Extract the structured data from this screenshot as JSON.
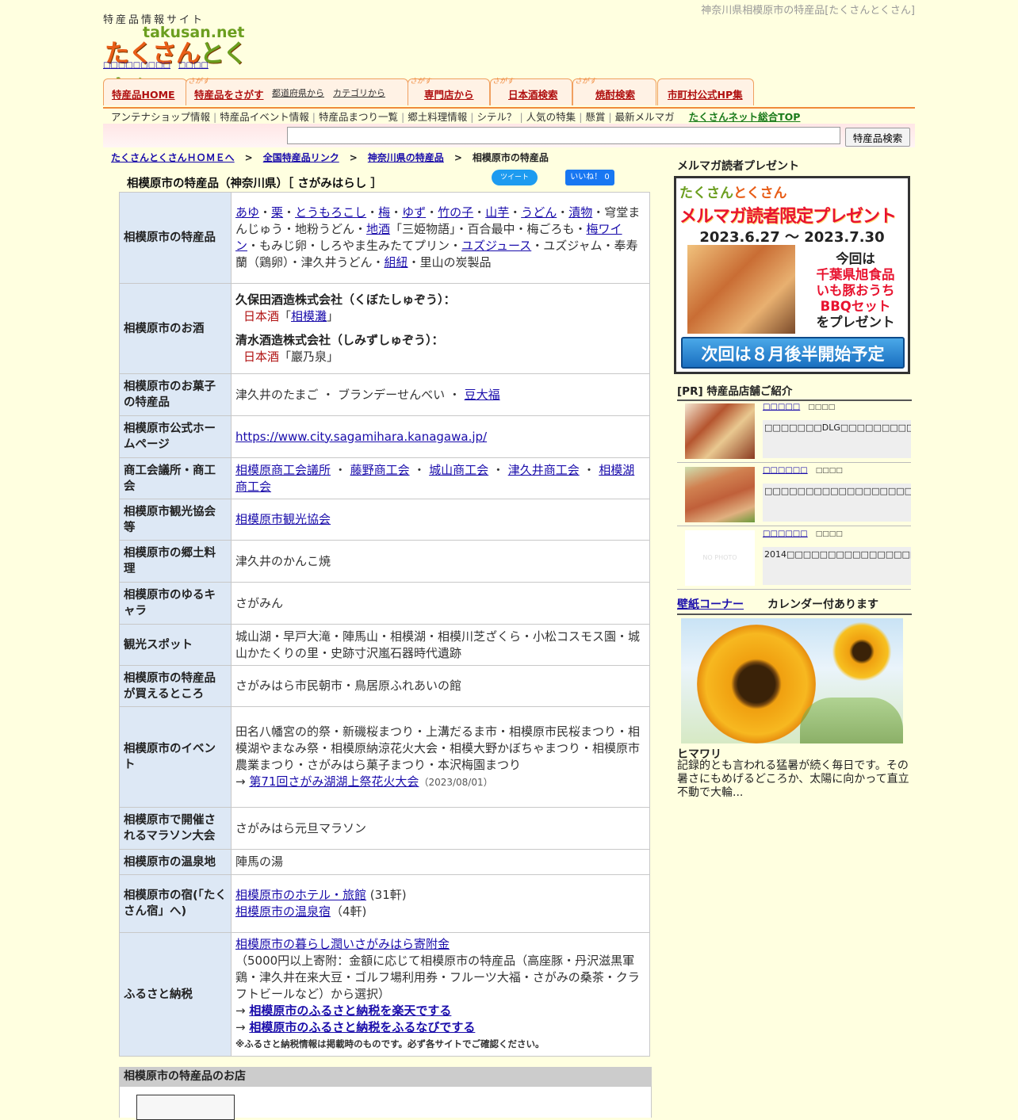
{
  "header": {
    "site_tag": "特産品情報サイト",
    "logo_top": "takusan.net",
    "logo_main": "たくさんとくさん",
    "logo_main_a": "たくさん",
    "logo_main_b": "とくさん",
    "page_heading": "神奈川県相模原市の特産品[たくさんとくさん]"
  },
  "tabs": [
    {
      "label": "特産品HOME"
    },
    {
      "label": "特産品をさがす",
      "badge": "さがす",
      "sub1": "都道府県から",
      "sub2": "カテゴリから"
    },
    {
      "label": "専門店から",
      "badge": "さがす"
    },
    {
      "label": "日本酒検索",
      "badge": "さがす"
    },
    {
      "label": "焼酎検索",
      "badge": "さがす"
    },
    {
      "label": "市町村公式HP集"
    }
  ],
  "sublinks": [
    "アンテナショップ情報",
    "特産品イベント情報",
    "特産品まつり一覧",
    "郷土料理情報",
    "シテル？",
    "人気の特集",
    "懸賞",
    "最新メルマガ"
  ],
  "sublinks_top": "たくさんネット総合TOP",
  "search": {
    "button": "特産品検索"
  },
  "breadcrumb": [
    "たくさんとくさんＨＯＭＥへ",
    "全国特産品リンク",
    "神奈川県の特産品",
    "相模原市の特産品"
  ],
  "breadcrumb_sep": ">",
  "title": "相模原市の特産品（神奈川県）［ さがみはらし ］",
  "social": {
    "tweet": "ツイート",
    "like": "いいね！ 0"
  },
  "table": {
    "specialty_h": "相模原市の特産品",
    "specialty_links": [
      "あゆ",
      "栗",
      "とうもろこし",
      "梅",
      "ゆず",
      "竹の子",
      "山芋",
      "うどん",
      "漬物"
    ],
    "specialty_t1": "・穹堂まんじゅう・地粉うどん・",
    "specialty_l2": "地酒",
    "specialty_t2": "「三姫物語」・百合最中・梅ごろも・",
    "specialty_l3": "梅ワイン",
    "specialty_t3": "・もみじ卵・しろやま生みたてプリン・",
    "specialty_l4": "ユズジュース",
    "specialty_t4": "・ユズジャム・奉寿蘭（鶏卵）・津久井うどん・",
    "specialty_l5": "組紐",
    "specialty_t5": "・里山の炭製品",
    "sake_h": "相模原市のお酒",
    "brewer1": "久保田酒造株式会社（くぼたしゅぞう）：",
    "sake_type": "日本酒",
    "brand1": "相模灘",
    "brewer2": "清水酒造株式会社（しみずしゅぞう）：",
    "brand2": "巖乃泉",
    "sweets_h": "相模原市のお菓子の特産品",
    "sweets_t": "津久井のたまご ・ ブランデーせんべい ・ ",
    "sweets_l": "豆大福",
    "hp_h": "相模原市公式ホームページ",
    "hp_url": "https://www.city.sagamihara.kanagawa.jp/",
    "chamber_h": "商工会議所・商工会",
    "chambers": [
      "相模原商工会議所",
      "藤野商工会",
      "城山商工会",
      "津久井商工会",
      "相模湖商工会"
    ],
    "tourism_h": "相模原市観光協会等",
    "tourism_l": "相模原市観光協会",
    "local_food_h": "相模原市の郷土料理",
    "local_food": "津久井のかんこ焼",
    "mascot_h": "相模原市のゆるキャラ",
    "mascot": "さがみん",
    "spots_h": "観光スポット",
    "spots": "城山湖・早戸大滝・陣馬山・相模湖・相模川芝ざくら・小松コスモス園・城山かたくりの里・史跡寸沢嵐石器時代遺跡",
    "buy_h": "相模原市の特産品が買えるところ",
    "buy": "さがみはら市民朝市・鳥居原ふれあいの館",
    "event_h": "相模原市のイベント",
    "events": "田名八幡宮の的祭・新磯桜まつり・上溝だるま市・相模原市民桜まつり・相模湖やまなみ祭・相模原納涼花火大会・相模大野かぼちゃまつり・相模原市農業まつり・さがみはら菓子まつり・本沢梅園まつり",
    "event_arrow": "→ ",
    "event_link": "第71回さがみ湖湖上祭花火大会",
    "event_date": "（2023/08/01）",
    "marathon_h": "相模原市で開催されるマラソン大会",
    "marathon": "さがみはら元旦マラソン",
    "onsen_h": "相模原市の温泉地",
    "onsen": "陣馬の湯",
    "inn_h": "相模原市の宿(「たくさん宿」へ)",
    "inn_l1": "相模原市のホテル・旅館",
    "inn_c1": "(31軒)",
    "inn_l2": "相模原市の温泉宿",
    "inn_c2": "（4軒)",
    "furusato_h": "ふるさと納税",
    "furusato_l": "相模原市の暮らし潤いさがみはら寄附金",
    "furusato_t": "（5000円以上寄附：金額に応じて相模原市の特産品（高座豚・丹沢滋黒軍鶏・津久井在来大豆・ゴルフ場利用券・フルーツ大福・さがみの桑茶・クラフトビールなど）から選択）",
    "furusato_arrow": "→ ",
    "furusato_rakuten": "相模原市のふるさと納税を楽天でする",
    "furusato_furunavi": "相模原市のふるさと納税をふるなびでする",
    "furusato_note": "※ふるさと納税情報は掲載時のものです。必ず各サイトでご確認ください。"
  },
  "shops_heading": "相模原市の特産品のお店",
  "right": {
    "mm_title": "メルマガ読者プレゼント",
    "banner_logo_a": "たくさん",
    "banner_logo_b": "とくさん",
    "banner_title": "メルマガ読者限定プレゼント",
    "banner_dates": "2023.6.27 〜 2023.7.30",
    "banner_l1": "今回は",
    "banner_l2": "千葉県旭食品",
    "banner_l3": "いも豚おうち",
    "banner_l4": "BBQセット",
    "banner_l5": "をプレゼント",
    "banner_button": "次回は８月後半開始予定",
    "pr_title": "[PR] 特産品店舗ご紹介",
    "pr_items": [
      {
        "name": "□□□□□",
        "tag": "□□□□",
        "desc": "□□□□□□□DLG□□□□□□□□□□□□□□□□□□□□□□..."
      },
      {
        "name": "□□□□□□",
        "tag": "□□□□",
        "desc": "□□□□□□□□□□□□□□□□□□□□□□□□□□□□□□□□□..."
      },
      {
        "name": "□□□□□□",
        "tag": "□□□□",
        "desc": "2014□□□□□□□□□□□□□□□□□□□□□□□□□□□□..."
      }
    ],
    "no_photo": "NO PHOTO",
    "wp_link": "壁紙コーナー",
    "wp_text": "カレンダー付あります",
    "wp_name": "ヒマワリ",
    "wp_desc": "記録的とも言われる猛暑が続く毎日です。その暑さにもめげるどころか、太陽に向かって直立不動で大輪..."
  },
  "colors": {
    "accent": "#f08a3c",
    "link": "#1a0dab",
    "header_cell": "#dde8f5",
    "page_bg": "#ffffe0"
  }
}
